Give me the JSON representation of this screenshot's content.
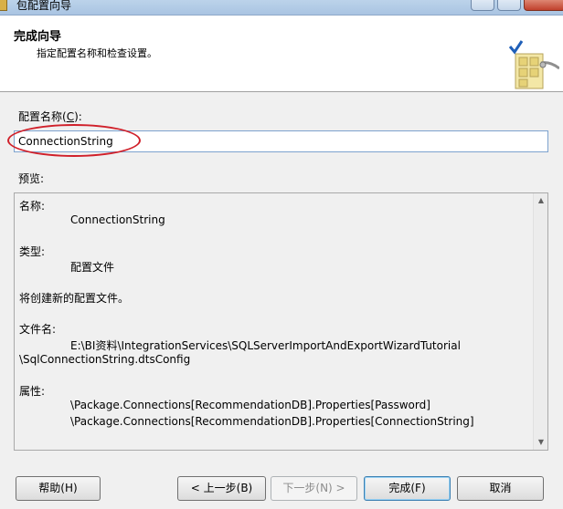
{
  "window": {
    "title": "包配置向导"
  },
  "header": {
    "title": "完成向导",
    "subtitle": "指定配置名称和检查设置。",
    "icon": "wizard-package-icon"
  },
  "config": {
    "label_prefix": "配置名称(",
    "label_mnemonic": "C",
    "label_suffix": "):",
    "value": "ConnectionString"
  },
  "preview": {
    "label": "预览:",
    "name_label": "名称:",
    "name_value": "ConnectionString",
    "type_label": "类型:",
    "type_value": "配置文件",
    "note": "将创建新的配置文件。",
    "filename_label": "文件名:",
    "filename_line1": "E:\\BI资料\\IntegrationServices\\SQLServerImportAndExportWizardTutorial",
    "filename_line2": "\\SqlConnectionString.dtsConfig",
    "properties_label": "属性:",
    "properties": [
      "\\Package.Connections[RecommendationDB].Properties[Password]",
      "\\Package.Connections[RecommendationDB].Properties[ConnectionString]"
    ]
  },
  "buttons": {
    "help": "帮助(H)",
    "back": "< 上一步(B)",
    "next": "下一步(N) >",
    "finish": "完成(F)",
    "cancel": "取消"
  },
  "colors": {
    "annotation_ellipse": "#d0202a",
    "input_border": "#7da2ce",
    "checkmark": "#1f5fb8"
  }
}
